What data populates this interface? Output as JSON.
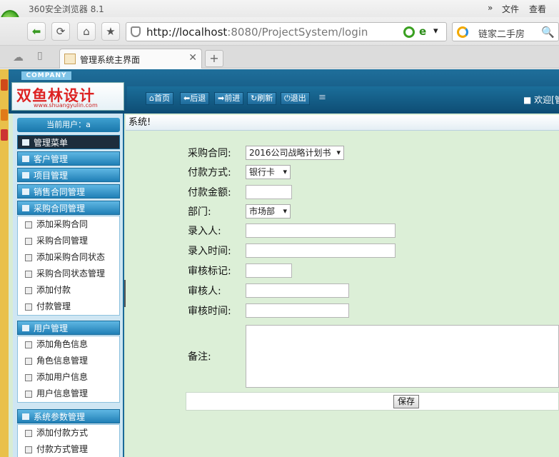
{
  "browser": {
    "app_title": "360安全浏览器 8.1",
    "menu_file": "文件",
    "menu_view": "查看",
    "url_host": "http://localhost",
    "url_rest": ":8080/ProjectSystem/login",
    "search_text": "链家二手房",
    "tab_title": "管理系统主界面",
    "new_tab": "+"
  },
  "header": {
    "company": "COMPANY",
    "brand_zh": "双鱼林设计",
    "brand_en": "www.shuangyulin.com",
    "buttons": {
      "home": "首页",
      "back": "后退",
      "forward": "前进",
      "refresh": "刷新",
      "logout": "退出"
    },
    "welcome": "欢迎[管理"
  },
  "sidebar": {
    "current_user": "当前用户：a",
    "main_menu": "管理菜单",
    "customer": "客户管理",
    "project": "项目管理",
    "sales_contract": "销售合同管理",
    "purchase_contract": "采购合同管理",
    "purchase_items": [
      "添加采购合同",
      "采购合同管理",
      "添加采购合同状态",
      "采购合同状态管理",
      "添加付款",
      "付款管理"
    ],
    "user_mgmt": "用户管理",
    "user_items": [
      "添加角色信息",
      "角色信息管理",
      "添加用户信息",
      "用户信息管理"
    ],
    "sys_params": "系统参数管理",
    "sys_items": [
      "添加付款方式",
      "付款方式管理"
    ]
  },
  "content": {
    "crumb": "系统!",
    "labels": {
      "contract": "采购合同:",
      "pay_method": "付款方式:",
      "amount": "付款金额:",
      "dept": "部门:",
      "entered_by": "录入人:",
      "entered_time": "录入时间:",
      "audit_mark": "审核标记:",
      "auditor": "审核人:",
      "audit_time": "审核时间:",
      "remarks": "备注:"
    },
    "values": {
      "contract": "2016公司战略计划书",
      "pay_method": "银行卡",
      "dept": "市场部"
    },
    "save": "保存"
  }
}
